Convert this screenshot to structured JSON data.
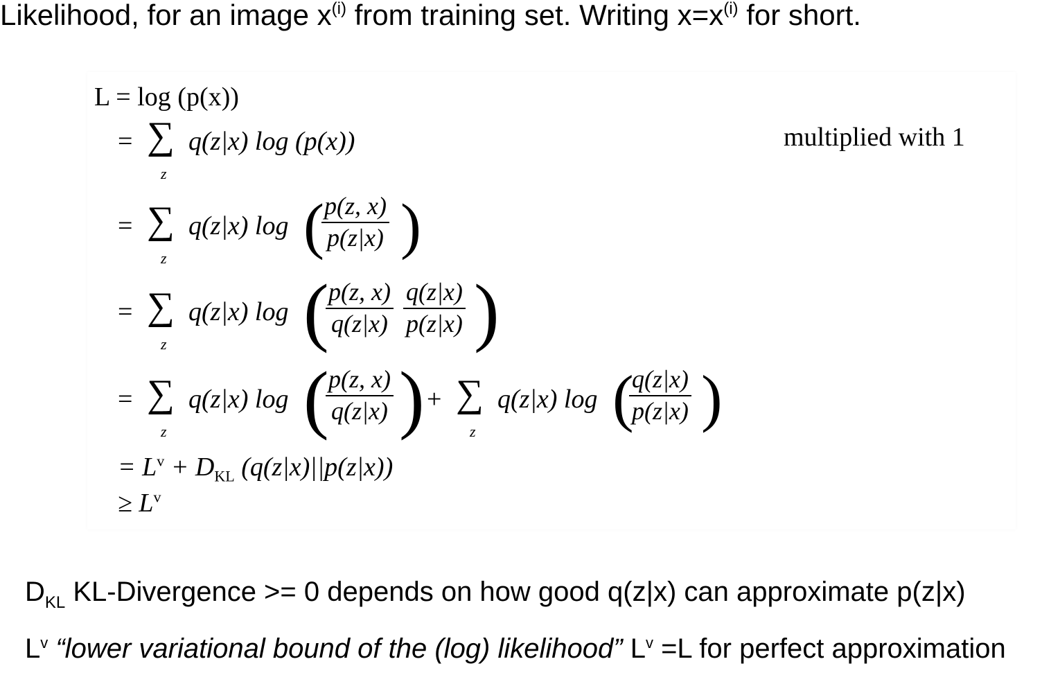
{
  "heading": {
    "part1": "Likelihood, for an image x",
    "sup1": "(i)",
    "part2": " from training set. Writing x=x",
    "sup2": "(i)",
    "part3": " for short."
  },
  "derivation": {
    "line1": "L = log (p(x))",
    "line2_tail": "q(z|x)  log (p(x))",
    "line2_note": "multiplied with 1",
    "line3_head": "q(z|x)  log",
    "line3_num": "p(z, x)",
    "line3_den": "p(z|x)",
    "line4_head": "q(z|x)  log",
    "line4_num1": "p(z, x)",
    "line4_den1": "q(z|x)",
    "line4_num2": "q(z|x)",
    "line4_den2": "p(z|x)",
    "line5_head": "q(z|x)  log",
    "line5_num1": "p(z, x)",
    "line5_den1": "q(z|x)",
    "line5_plus": "+",
    "line5_head2": "q(z|x)  log",
    "line5_num2": "q(z|x)",
    "line5_den2": "p(z|x)",
    "line6_a": "= L",
    "line6_sup": "v",
    "line6_b": " + D",
    "line6_sub": "KL",
    "line6_c": " (q(z|x)||p(z|x))",
    "line7_a": "≥ L",
    "line7_sup": "v",
    "sum_symbol": "∑",
    "sum_index": "z",
    "equals": "="
  },
  "footer": {
    "line1_D": "D",
    "line1_sub": "KL",
    "line1_rest": " KL-Divergence >= 0 depends on how good q(z|x) can approximate p(z|x)",
    "line2_L": "L",
    "line2_sup": "v",
    "line2_quote": " “lower variational bound of the (log) likelihood”",
    "line2_L2": " L",
    "line2_sup2": "v",
    "line2_rest": " =L for perfect approximation"
  }
}
